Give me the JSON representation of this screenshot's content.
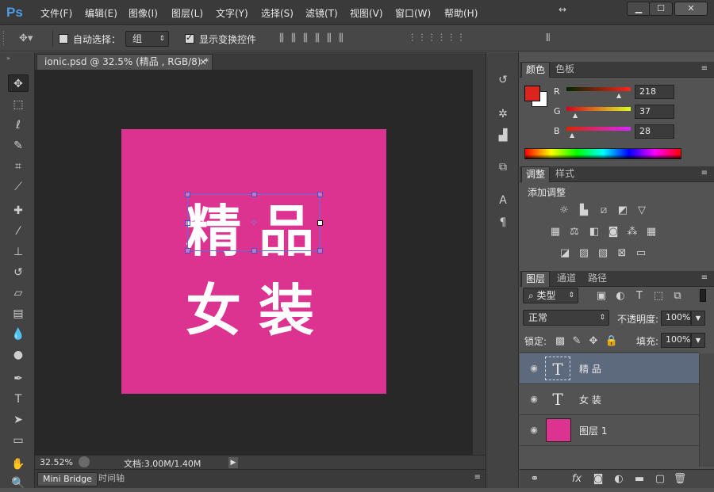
{
  "app": {
    "logo": "Ps"
  },
  "menu": [
    "文件(F)",
    "编辑(E)",
    "图像(I)",
    "图层(L)",
    "文字(Y)",
    "选择(S)",
    "滤镜(T)",
    "视图(V)",
    "窗口(W)",
    "帮助(H)"
  ],
  "window_controls": {
    "arrows": "↔",
    "minimize": "▁",
    "maximize": "☐",
    "close": "✕"
  },
  "options": {
    "auto_select_label": "自动选择：",
    "auto_select_value": "组",
    "show_transform_label": "显示变换控件"
  },
  "document": {
    "tab_title": "ionic.psd @ 32.5% (精品 , RGB/8) *",
    "close": "×",
    "line1": "精品",
    "line2": "女装",
    "canvas_color": "#dc3390"
  },
  "status": {
    "zoom": "32.52%",
    "doc_info": "文档:3.00M/1.40M"
  },
  "bottom_tabs": [
    "Mini Bridge",
    "时间轴"
  ],
  "color_panel": {
    "tabs": [
      "颜色",
      "色板"
    ],
    "r_label": "R",
    "r_value": "218",
    "g_label": "G",
    "g_value": "37",
    "b_label": "B",
    "b_value": "28",
    "foreground": "#da251c",
    "background": "#ffffff"
  },
  "adjust_panel": {
    "tabs": [
      "调整",
      "样式"
    ],
    "add_label": "添加调整"
  },
  "layers_panel": {
    "tabs": [
      "图层",
      "通道",
      "路径"
    ],
    "filter_label": "类型",
    "blend_mode": "正常",
    "opacity_label": "不透明度:",
    "opacity_value": "100%",
    "lock_label": "锁定:",
    "fill_label": "填充:",
    "fill_value": "100%",
    "layers": [
      {
        "name": "精 品",
        "kind": "text",
        "selected": true
      },
      {
        "name": "女 装",
        "kind": "text",
        "selected": false
      },
      {
        "name": "图层 1",
        "kind": "pixel",
        "selected": false,
        "color": "#dc3390"
      }
    ]
  }
}
